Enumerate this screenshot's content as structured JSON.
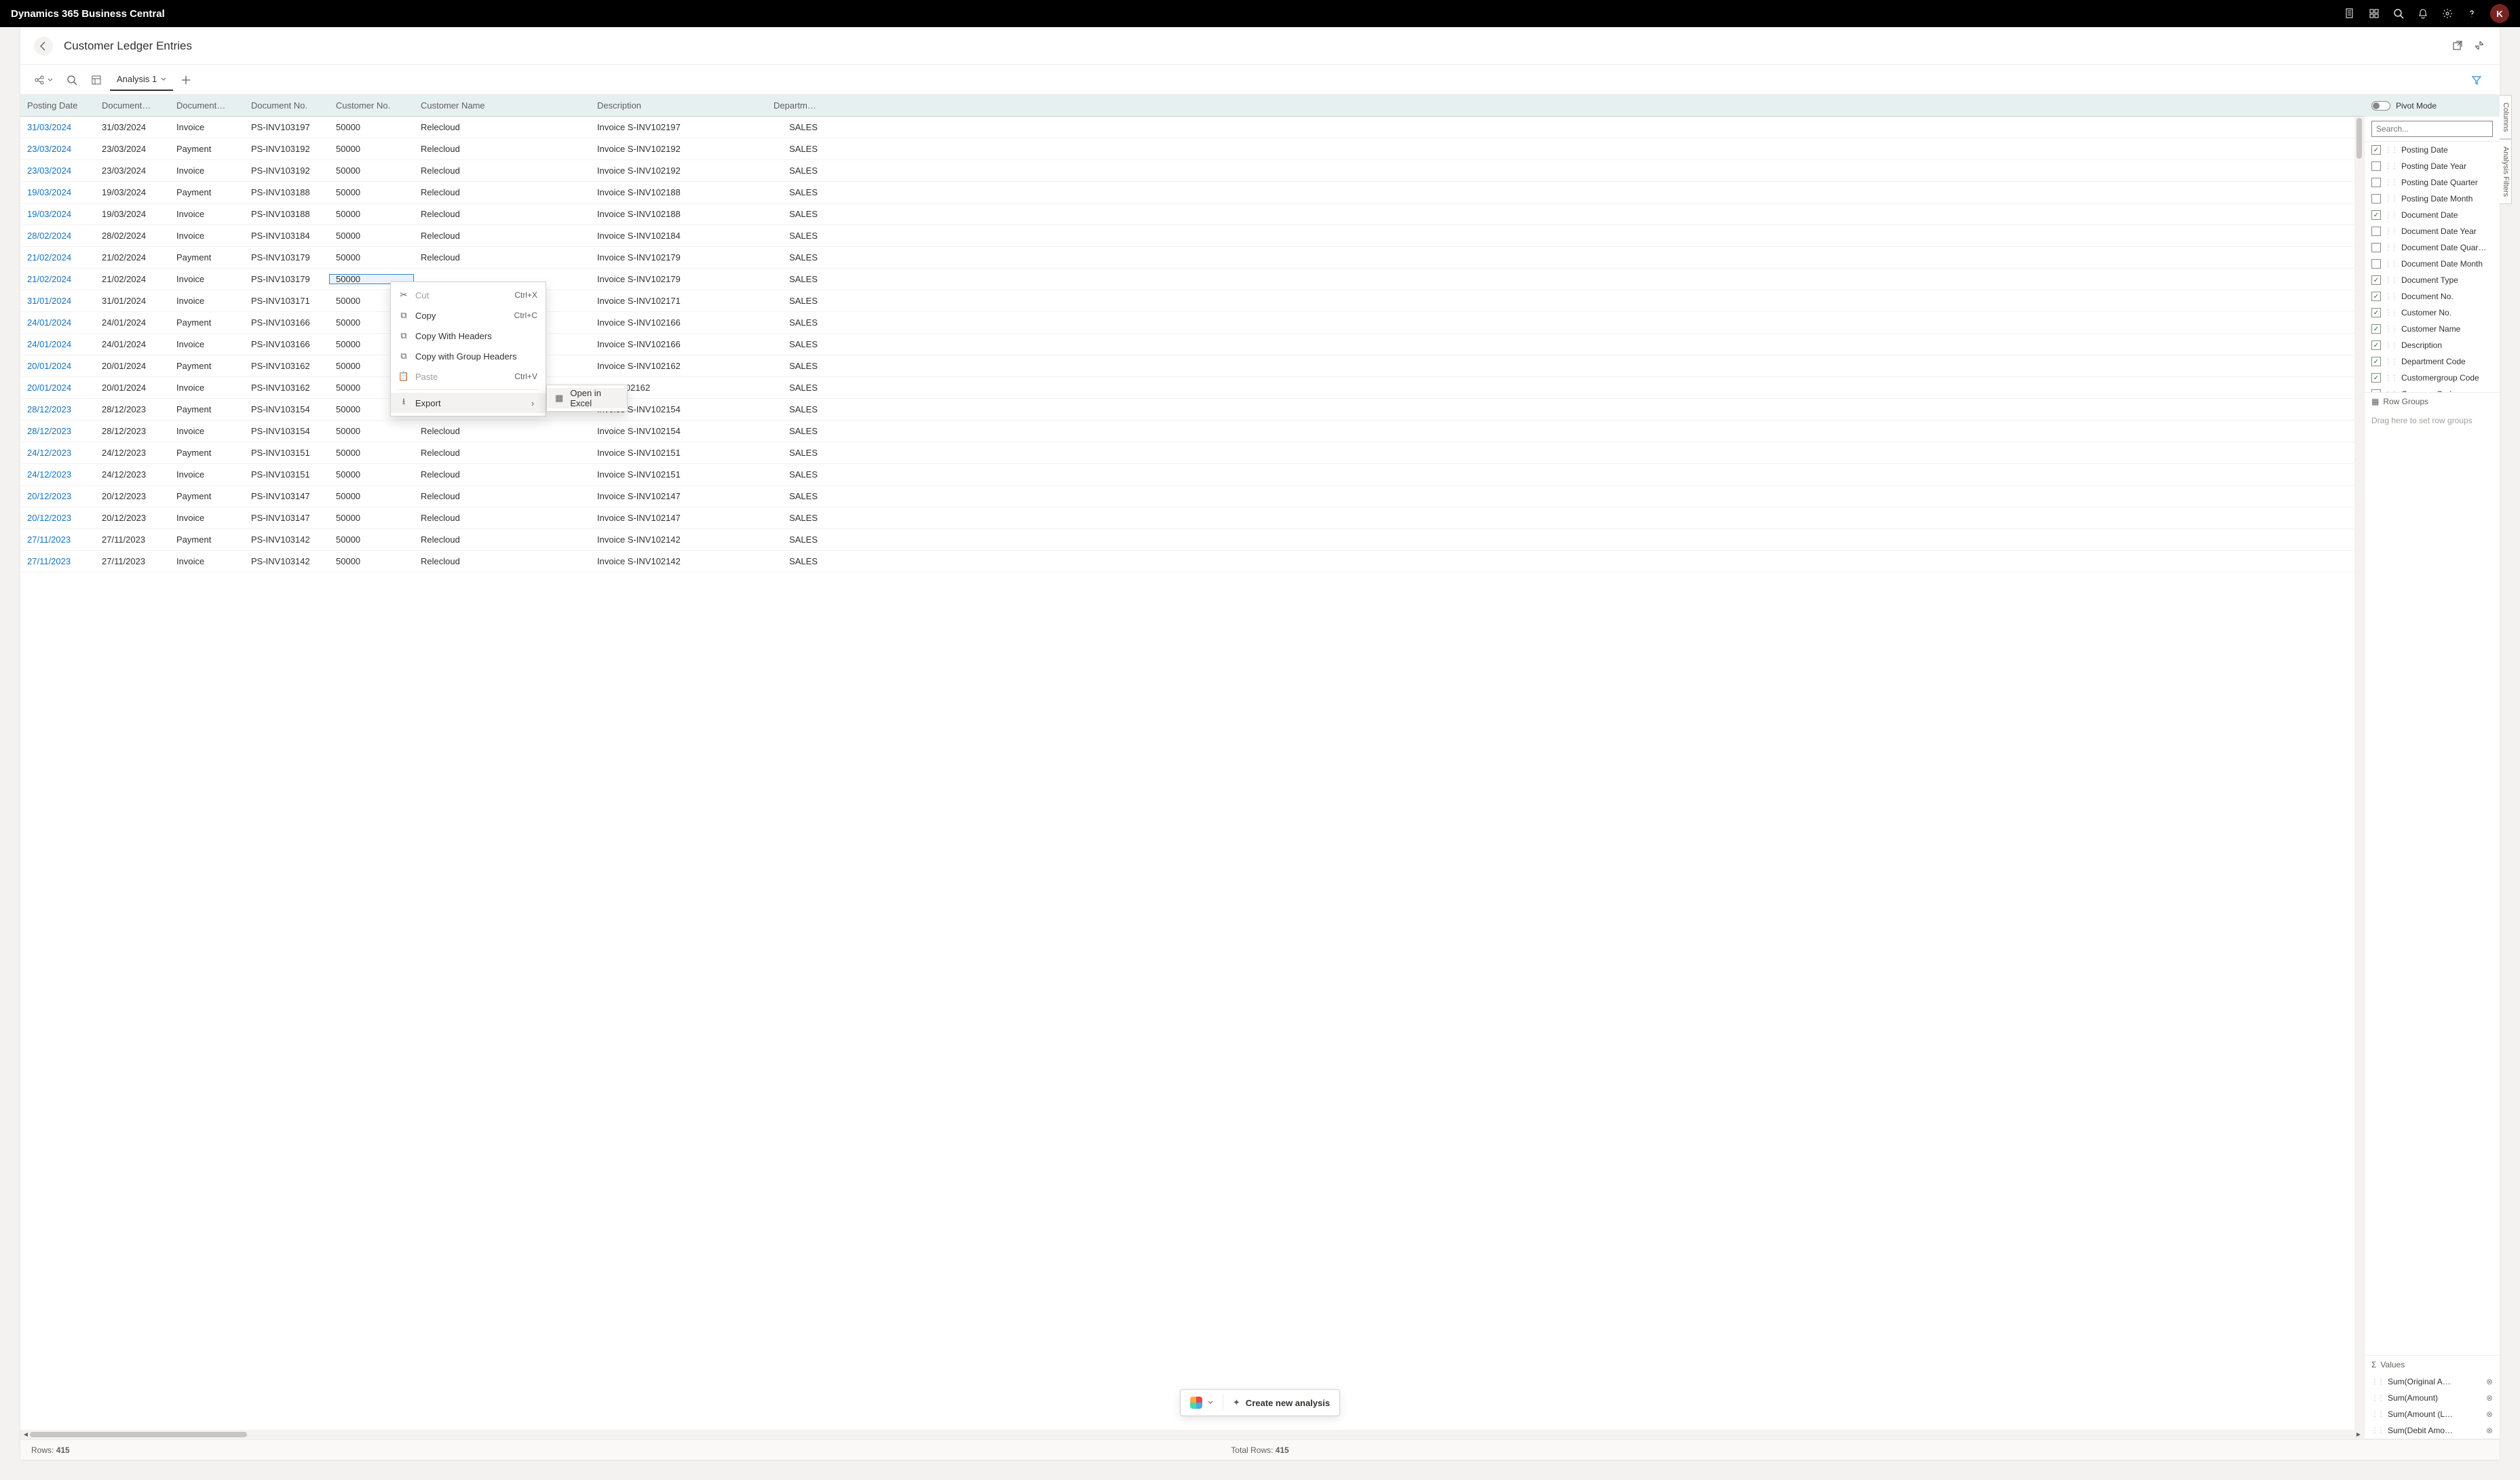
{
  "app_title": "Dynamics 365 Business Central",
  "avatar_letter": "K",
  "page_title": "Customer Ledger Entries",
  "toolbar": {
    "analysis_tab": "Analysis 1"
  },
  "grid": {
    "headers": {
      "posting_date": "Posting Date",
      "document_date": "Document…",
      "document_type": "Document…",
      "document_no": "Document No.",
      "customer_no": "Customer No.",
      "customer_name": "Customer Name",
      "description": "Description",
      "department": "Department…"
    },
    "selected_cell_row": 7,
    "selected_cell_col": "customer_no",
    "rows": [
      {
        "posting_date": "31/03/2024",
        "doc_date": "31/03/2024",
        "doc_type": "Invoice",
        "doc_no": "PS-INV103197",
        "cust_no": "50000",
        "cust_name": "Relecloud",
        "desc": "Invoice S-INV102197",
        "dept": "SALES"
      },
      {
        "posting_date": "23/03/2024",
        "doc_date": "23/03/2024",
        "doc_type": "Payment",
        "doc_no": "PS-INV103192",
        "cust_no": "50000",
        "cust_name": "Relecloud",
        "desc": "Invoice S-INV102192",
        "dept": "SALES"
      },
      {
        "posting_date": "23/03/2024",
        "doc_date": "23/03/2024",
        "doc_type": "Invoice",
        "doc_no": "PS-INV103192",
        "cust_no": "50000",
        "cust_name": "Relecloud",
        "desc": "Invoice S-INV102192",
        "dept": "SALES"
      },
      {
        "posting_date": "19/03/2024",
        "doc_date": "19/03/2024",
        "doc_type": "Payment",
        "doc_no": "PS-INV103188",
        "cust_no": "50000",
        "cust_name": "Relecloud",
        "desc": "Invoice S-INV102188",
        "dept": "SALES"
      },
      {
        "posting_date": "19/03/2024",
        "doc_date": "19/03/2024",
        "doc_type": "Invoice",
        "doc_no": "PS-INV103188",
        "cust_no": "50000",
        "cust_name": "Relecloud",
        "desc": "Invoice S-INV102188",
        "dept": "SALES"
      },
      {
        "posting_date": "28/02/2024",
        "doc_date": "28/02/2024",
        "doc_type": "Invoice",
        "doc_no": "PS-INV103184",
        "cust_no": "50000",
        "cust_name": "Relecloud",
        "desc": "Invoice S-INV102184",
        "dept": "SALES"
      },
      {
        "posting_date": "21/02/2024",
        "doc_date": "21/02/2024",
        "doc_type": "Payment",
        "doc_no": "PS-INV103179",
        "cust_no": "50000",
        "cust_name": "Relecloud",
        "desc": "Invoice S-INV102179",
        "dept": "SALES"
      },
      {
        "posting_date": "21/02/2024",
        "doc_date": "21/02/2024",
        "doc_type": "Invoice",
        "doc_no": "PS-INV103179",
        "cust_no": "50000",
        "cust_name": "",
        "desc": "Invoice S-INV102179",
        "dept": "SALES"
      },
      {
        "posting_date": "31/01/2024",
        "doc_date": "31/01/2024",
        "doc_type": "Invoice",
        "doc_no": "PS-INV103171",
        "cust_no": "50000",
        "cust_name": "",
        "desc": "Invoice S-INV102171",
        "dept": "SALES"
      },
      {
        "posting_date": "24/01/2024",
        "doc_date": "24/01/2024",
        "doc_type": "Payment",
        "doc_no": "PS-INV103166",
        "cust_no": "50000",
        "cust_name": "",
        "desc": "Invoice S-INV102166",
        "dept": "SALES"
      },
      {
        "posting_date": "24/01/2024",
        "doc_date": "24/01/2024",
        "doc_type": "Invoice",
        "doc_no": "PS-INV103166",
        "cust_no": "50000",
        "cust_name": "",
        "desc": "Invoice S-INV102166",
        "dept": "SALES"
      },
      {
        "posting_date": "20/01/2024",
        "doc_date": "20/01/2024",
        "doc_type": "Payment",
        "doc_no": "PS-INV103162",
        "cust_no": "50000",
        "cust_name": "",
        "desc": "Invoice S-INV102162",
        "dept": "SALES"
      },
      {
        "posting_date": "20/01/2024",
        "doc_date": "20/01/2024",
        "doc_type": "Invoice",
        "doc_no": "PS-INV103162",
        "cust_no": "50000",
        "cust_name": "",
        "desc": "S-INV102162",
        "dept": "SALES"
      },
      {
        "posting_date": "28/12/2023",
        "doc_date": "28/12/2023",
        "doc_type": "Payment",
        "doc_no": "PS-INV103154",
        "cust_no": "50000",
        "cust_name": "Relecloud",
        "desc": "Invoice S-INV102154",
        "dept": "SALES"
      },
      {
        "posting_date": "28/12/2023",
        "doc_date": "28/12/2023",
        "doc_type": "Invoice",
        "doc_no": "PS-INV103154",
        "cust_no": "50000",
        "cust_name": "Relecloud",
        "desc": "Invoice S-INV102154",
        "dept": "SALES"
      },
      {
        "posting_date": "24/12/2023",
        "doc_date": "24/12/2023",
        "doc_type": "Payment",
        "doc_no": "PS-INV103151",
        "cust_no": "50000",
        "cust_name": "Relecloud",
        "desc": "Invoice S-INV102151",
        "dept": "SALES"
      },
      {
        "posting_date": "24/12/2023",
        "doc_date": "24/12/2023",
        "doc_type": "Invoice",
        "doc_no": "PS-INV103151",
        "cust_no": "50000",
        "cust_name": "Relecloud",
        "desc": "Invoice S-INV102151",
        "dept": "SALES"
      },
      {
        "posting_date": "20/12/2023",
        "doc_date": "20/12/2023",
        "doc_type": "Payment",
        "doc_no": "PS-INV103147",
        "cust_no": "50000",
        "cust_name": "Relecloud",
        "desc": "Invoice S-INV102147",
        "dept": "SALES"
      },
      {
        "posting_date": "20/12/2023",
        "doc_date": "20/12/2023",
        "doc_type": "Invoice",
        "doc_no": "PS-INV103147",
        "cust_no": "50000",
        "cust_name": "Relecloud",
        "desc": "Invoice S-INV102147",
        "dept": "SALES"
      },
      {
        "posting_date": "27/11/2023",
        "doc_date": "27/11/2023",
        "doc_type": "Payment",
        "doc_no": "PS-INV103142",
        "cust_no": "50000",
        "cust_name": "Relecloud",
        "desc": "Invoice S-INV102142",
        "dept": "SALES"
      },
      {
        "posting_date": "27/11/2023",
        "doc_date": "27/11/2023",
        "doc_type": "Invoice",
        "doc_no": "PS-INV103142",
        "cust_no": "50000",
        "cust_name": "Relecloud",
        "desc": "Invoice S-INV102142",
        "dept": "SALES"
      }
    ]
  },
  "context_menu": {
    "cut": "Cut",
    "cut_key": "Ctrl+X",
    "copy": "Copy",
    "copy_key": "Ctrl+C",
    "copy_headers": "Copy With Headers",
    "copy_group_headers": "Copy with Group Headers",
    "paste": "Paste",
    "paste_key": "Ctrl+V",
    "export": "Export",
    "open_excel": "Open in Excel"
  },
  "side": {
    "pivot_label": "Pivot Mode",
    "search_placeholder": "Search...",
    "columns_tab": "Columns",
    "filters_tab": "Analysis Filters",
    "fields": [
      {
        "label": "Posting Date",
        "c": true
      },
      {
        "label": "Posting Date Year",
        "c": false
      },
      {
        "label": "Posting Date Quarter",
        "c": false
      },
      {
        "label": "Posting Date Month",
        "c": false
      },
      {
        "label": "Document Date",
        "c": true
      },
      {
        "label": "Document Date Year",
        "c": false
      },
      {
        "label": "Document Date Quar…",
        "c": false
      },
      {
        "label": "Document Date Month",
        "c": false
      },
      {
        "label": "Document Type",
        "c": true
      },
      {
        "label": "Document No.",
        "c": true
      },
      {
        "label": "Customer No.",
        "c": true
      },
      {
        "label": "Customer Name",
        "c": true
      },
      {
        "label": "Description",
        "c": true
      },
      {
        "label": "Department Code",
        "c": true
      },
      {
        "label": "Customergroup Code",
        "c": true
      },
      {
        "label": "Currency Code",
        "c": true
      }
    ],
    "row_groups_label": "Row Groups",
    "row_groups_hint": "Drag here to set row groups",
    "values_label": "Values",
    "values": [
      "Sum(Original A…",
      "Sum(Amount)",
      "Sum(Amount (L…",
      "Sum(Debit Amo…"
    ]
  },
  "float_bar": {
    "create": "Create new analysis"
  },
  "footer": {
    "rows_label": "Rows: ",
    "rows_count": "415",
    "total_label": "Total Rows: ",
    "total_count": "415"
  }
}
